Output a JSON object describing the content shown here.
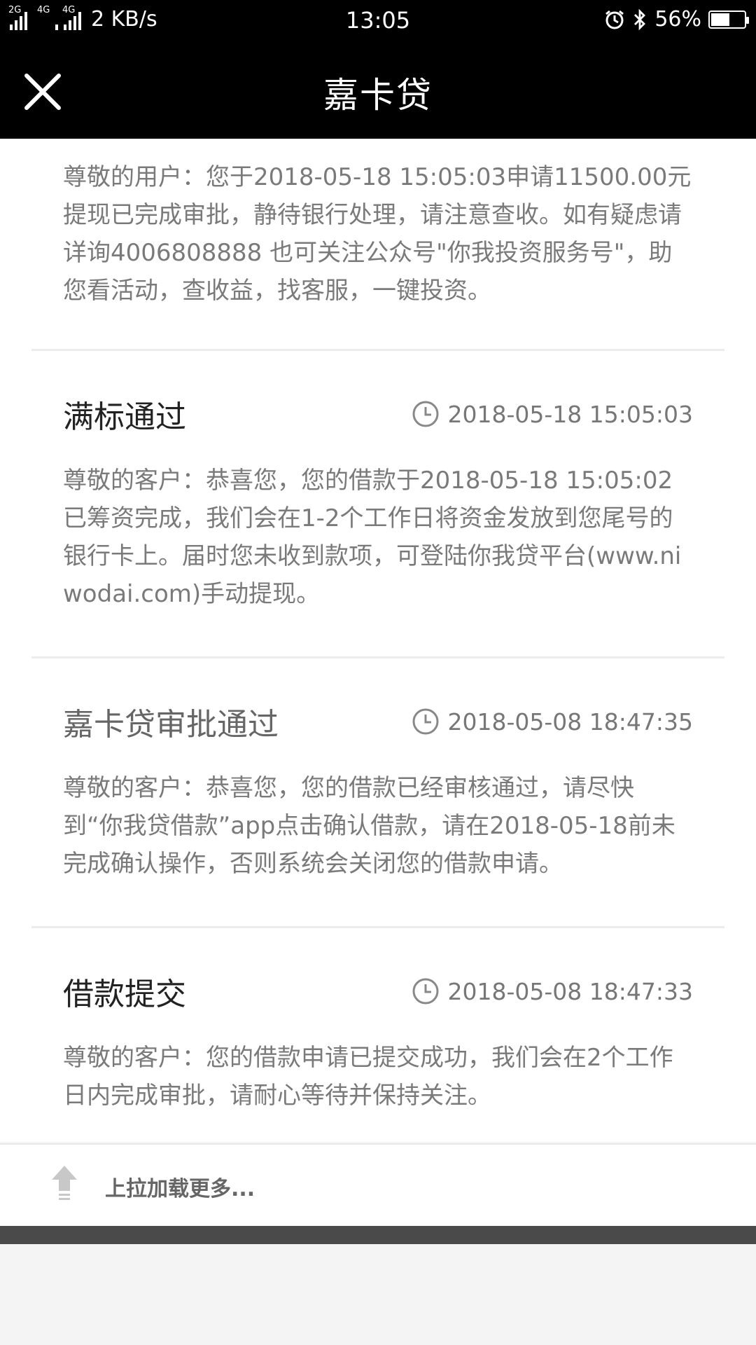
{
  "status_bar": {
    "signal1_label": "2G",
    "signal2_label": "4G",
    "signal3_label": "4G",
    "network_speed": "2 KB/s",
    "time": "13:05",
    "battery_percent": "56%",
    "battery_level": 0.56
  },
  "header": {
    "title": "嘉卡贷"
  },
  "messages": [
    {
      "title": "",
      "time": "",
      "body": "尊敬的用户：您于2018-05-18 15:05:03申请11500.00元提现已完成审批，静待银行处理，请注意查收。如有疑虑请详询4006808888 也可关注公众号\"你我投资服务号\"，助您看活动，查收益，找客服，一键投资。"
    },
    {
      "title": "满标通过",
      "time": "2018-05-18 15:05:03",
      "body": "尊敬的客户：恭喜您，您的借款于2018-05-18 15:05:02已筹资完成，我们会在1-2个工作日将资金发放到您尾号的银行卡上。届时您未收到款项，可登陆你我贷平台(www.niwodai.com)手动提现。"
    },
    {
      "title": "嘉卡贷审批通过",
      "time": "2018-05-08 18:47:35",
      "body": "尊敬的客户：恭喜您，您的借款已经审核通过，请尽快到“你我贷借款”app点击确认借款，请在2018-05-18前未完成确认操作，否则系统会关闭您的借款申请。"
    },
    {
      "title": "借款提交",
      "time": "2018-05-08 18:47:33",
      "body": "尊敬的客户：您的借款申请已提交成功，我们会在2个工作日内完成审批，请耐心等待并保持关注。"
    }
  ],
  "footer": {
    "load_more_text": "上拉加载更多..."
  }
}
